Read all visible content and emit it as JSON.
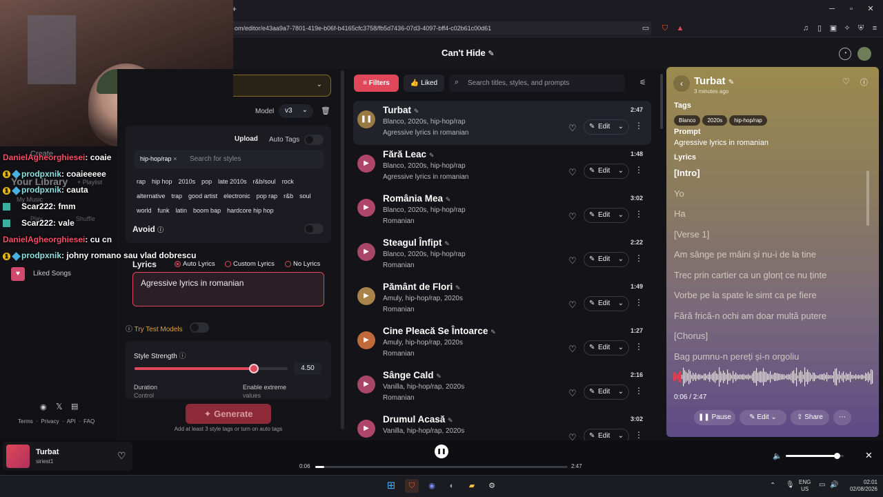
{
  "browser": {
    "new_tab": "+",
    "url": "om/editor/e43aa9a7-7801-419e-b06f-b4165cfc3758/fb5d7436-07d3-4097-bff4-c02b61c00d61"
  },
  "header": {
    "title": "Can't Hide"
  },
  "sidebar": {
    "create": "Create",
    "library": "Your Library",
    "playlist": "+ Playlist",
    "my_music": "My Music",
    "play": "Play",
    "shuffle": "Shuffle",
    "liked_songs": "Liked Songs",
    "footer": [
      "Terms",
      "Privacy",
      "API",
      "FAQ"
    ]
  },
  "chat": [
    {
      "name": "DanielAgheorghiesei",
      "msg": "coaie",
      "color": "n1",
      "badges": false
    },
    {
      "name": "prodpxnik",
      "msg": "coaieeeee",
      "color": "n2",
      "badges": true
    },
    {
      "name": "prodpxnik",
      "msg": "cauta",
      "color": "n2",
      "badges": true
    },
    {
      "name": "Scar222",
      "msg": "fmm",
      "color": "n3",
      "badges": false
    },
    {
      "name": "Scar222",
      "msg": "vale",
      "color": "n3",
      "badges": false
    },
    {
      "name": "DanielAgheorghiesei",
      "msg": "cu cn",
      "color": "n1",
      "badges": false
    },
    {
      "name": "prodpxnik",
      "msg": "johny romano sau vlad dobrescu",
      "color": "n2",
      "badges": true
    }
  ],
  "create": {
    "model_label": "Model",
    "model_value": "v3",
    "upload": "Upload",
    "auto_tags": "Auto Tags",
    "selected_tag": "hip-hop/rap",
    "styles_placeholder": "Search for styles",
    "style_tags": [
      "rap",
      "hip hop",
      "2010s",
      "pop",
      "late 2010s",
      "r&b/soul",
      "rock",
      "alternative",
      "trap",
      "good artist",
      "electronic",
      "pop rap",
      "r&b",
      "soul",
      "world",
      "funk",
      "latin",
      "boom bap",
      "hardcore hip hop"
    ],
    "avoid": "Avoid",
    "lyrics_label": "Lyrics",
    "lyrics_modes": [
      "Auto Lyrics",
      "Custom Lyrics",
      "No Lyrics"
    ],
    "lyrics_prompt": "Agressive lyrics in romanian",
    "try_test": "Try Test Models",
    "style_strength": "Style Strength",
    "style_strength_value": "4.50",
    "style_strength_fraction": 0.78,
    "duration": "Duration",
    "control": "Control",
    "enable_extreme": "Enable extreme",
    "values": "values",
    "generate": "Generate",
    "hint": "Add at least 3 style tags or turn on auto tags"
  },
  "list": {
    "filters": "Filters",
    "liked": "Liked",
    "search_placeholder": "Search titles, styles, and prompts",
    "songs": [
      {
        "title": "Turbat",
        "tags": "Blanco, 2020s, hip-hop/rap",
        "prompt": "Agressive lyrics in romanian",
        "duration": "2:47",
        "color": "#9a7a44",
        "icon": "❚❚"
      },
      {
        "title": "Fără Leac",
        "tags": "Blanco, 2020s, hip-hop/rap",
        "prompt": "Agressive lyrics in romanian",
        "duration": "1:48",
        "color": "#b0456a",
        "icon": "▶"
      },
      {
        "title": "România Mea",
        "tags": "Blanco, 2020s, hip-hop/rap",
        "prompt": "Romanian",
        "duration": "3:02",
        "color": "#b0456a",
        "icon": "▶"
      },
      {
        "title": "Steagul Înfipt",
        "tags": "Blanco, 2020s, hip-hop/rap",
        "prompt": "Romanian",
        "duration": "2:22",
        "color": "#a84668",
        "icon": "▶"
      },
      {
        "title": "Pământ de Flori",
        "tags": "Amuly, hip-hop/rap, 2020s",
        "prompt": "Romanian",
        "duration": "1:49",
        "color": "#a8834c",
        "icon": "▶"
      },
      {
        "title": "Cine Pleacă Se Întoarce",
        "tags": "Amuly, hip-hop/rap, 2020s",
        "prompt": "Romanian",
        "duration": "1:27",
        "color": "#c06a3c",
        "icon": "▶"
      },
      {
        "title": "Sânge Cald",
        "tags": "Vanilla, hip-hop/rap, 2020s",
        "prompt": "Romanian",
        "duration": "2:16",
        "color": "#a84668",
        "icon": "▶"
      },
      {
        "title": "Drumul Acasă",
        "tags": "Vanilla, hip-hop/rap, 2020s",
        "prompt": "",
        "duration": "3:02",
        "color": "#b0456a",
        "icon": "▶"
      }
    ],
    "edit": "Edit"
  },
  "detail": {
    "title": "Turbat",
    "time_ago": "3 minutes ago",
    "tags_label": "Tags",
    "tags": [
      "Blanco",
      "2020s",
      "hip-hop/rap"
    ],
    "prompt_label": "Prompt",
    "prompt": "Agressive lyrics in romanian",
    "lyrics_label": "Lyrics",
    "lyrics": [
      "[Intro]",
      "Yo",
      "Ha",
      "[Verse 1]",
      "Am sânge pe mâini și nu-i de la tine",
      "Trec prin cartier ca un glonț ce nu ținte",
      "Vorbe pe la spate le simt ca pe fiere",
      "Fără frică-n ochi am doar multă putere",
      "[Chorus]",
      "Bag pumnu-n pereți și-n orgoliu"
    ],
    "time": "0:06 / 2:47",
    "pause": "Pause",
    "edit": "Edit",
    "share": "Share",
    "progress_fraction": 0.036
  },
  "player": {
    "title": "Turbat",
    "artist": "siriest1",
    "elapsed": "0:06",
    "total": "2:47",
    "progress_fraction": 0.036,
    "volume_fraction": 0.88
  },
  "taskbar": {
    "lang": "ENG",
    "region": "US",
    "time": "02:01",
    "date": "02/08/2026"
  }
}
